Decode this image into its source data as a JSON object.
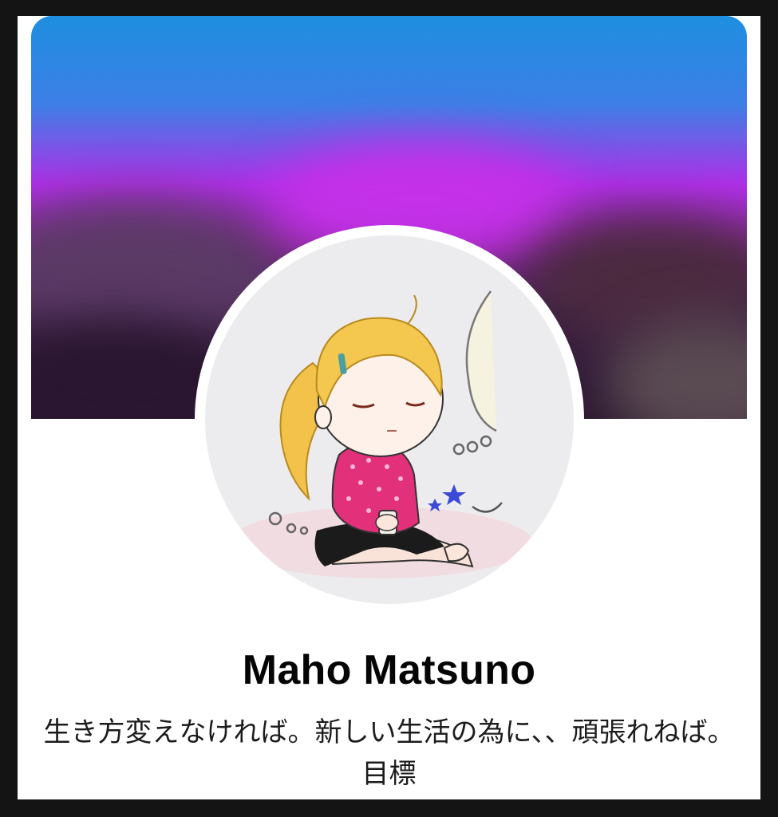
{
  "profile": {
    "name": "Maho Matsuno",
    "bio": "生き方変えなければ。新しい生活の為に、、頑張れねば。目標"
  },
  "colors": {
    "cover_top": "#1e8fe0",
    "cover_mid": "#b02fe8",
    "cover_bottom": "#2b1830",
    "avatar_bg": "#ececee",
    "name_text": "#050505"
  },
  "icons": {
    "avatar": "cartoon-girl-avatar",
    "cover": "blurred-cover-photo"
  }
}
